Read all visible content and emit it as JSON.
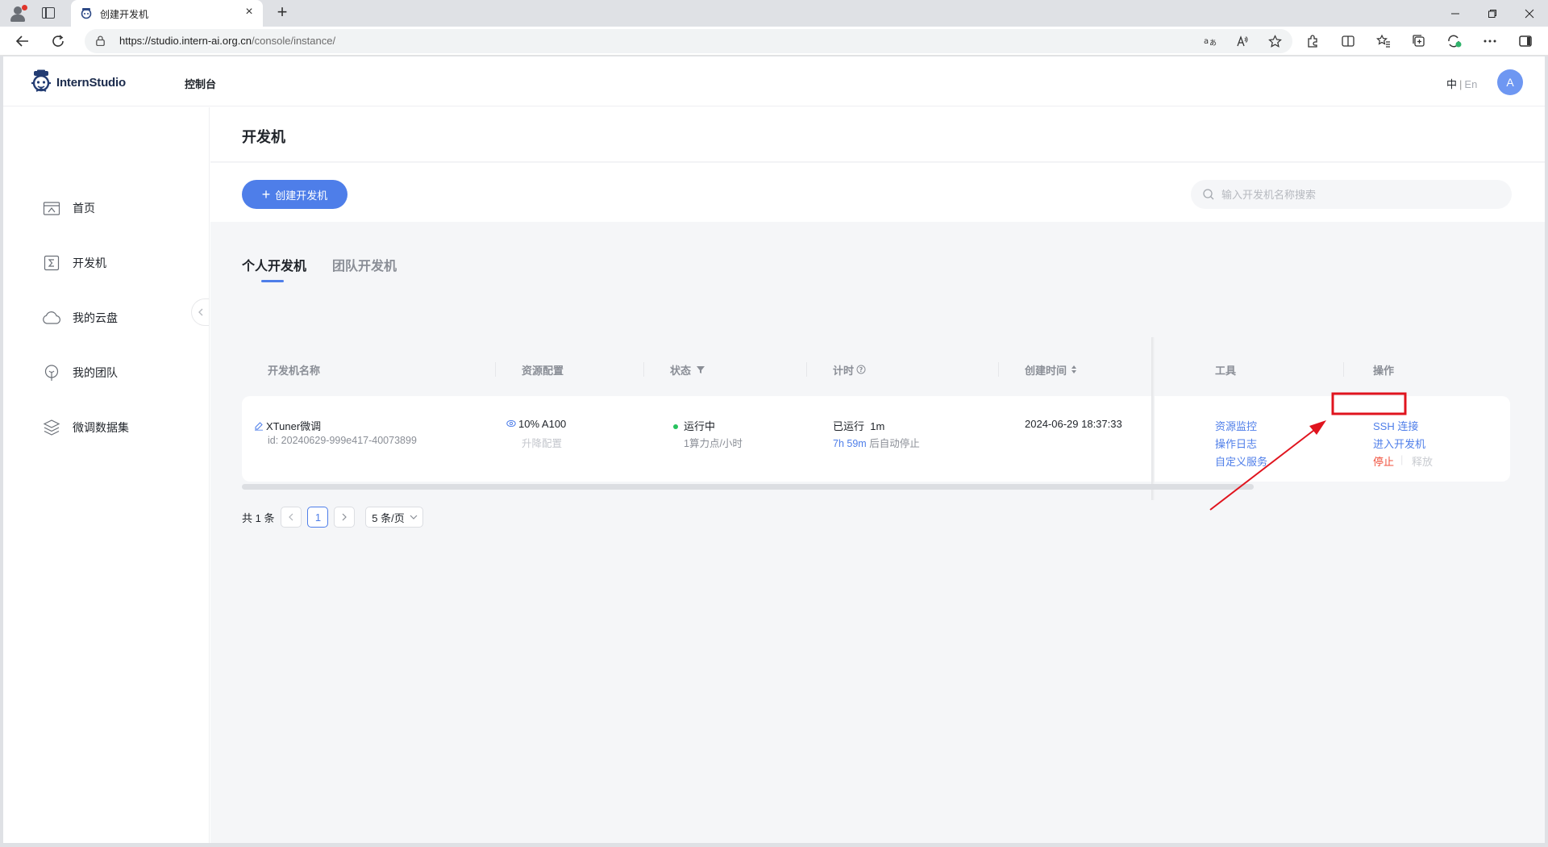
{
  "browser": {
    "tab_title": "创建开发机",
    "url_host": "https://studio.intern-ai.org.cn",
    "url_path": "/console/instance/",
    "new_tab": "+",
    "tab_close": "×"
  },
  "header": {
    "brand": "InternStudio",
    "nav_console": "控制台",
    "lang_zh": "中",
    "lang_sep": "|",
    "lang_en": "En",
    "avatar_letter": "A"
  },
  "sidebar": {
    "items": [
      {
        "label": "首页",
        "icon": "home-icon"
      },
      {
        "label": "开发机",
        "icon": "terminal-icon"
      },
      {
        "label": "我的云盘",
        "icon": "cloud-icon"
      },
      {
        "label": "我的团队",
        "icon": "team-icon"
      },
      {
        "label": "微调数据集",
        "icon": "layers-icon"
      }
    ]
  },
  "main": {
    "page_title": "开发机",
    "create_button": "创建开发机",
    "search_placeholder": "输入开发机名称搜索",
    "tabs": [
      "个人开发机",
      "团队开发机"
    ],
    "table": {
      "headers": [
        "开发机名称",
        "资源配置",
        "状态",
        "计时",
        "创建时间",
        "工具",
        "操作"
      ],
      "rows": [
        {
          "name": "XTuner微调",
          "id": "id: 20240629-999e417-40073899",
          "resource": "10% A100",
          "resource_action": "升降配置",
          "status": "运行中",
          "cost": "1算力点/小时",
          "timer_label": "已运行",
          "timer_value": "1m",
          "auto_stop_time": "7h 59m",
          "auto_stop_suffix": "后自动停止",
          "created": "2024-06-29 18:37:33",
          "tools": [
            "资源监控",
            "操作日志",
            "自定义服务"
          ],
          "ops": {
            "ssh": "SSH 连接",
            "enter": "进入开发机",
            "stop": "停止",
            "release": "释放"
          }
        }
      ]
    },
    "pagination": {
      "total": "共 1 条",
      "current_page": "1",
      "page_size": "5 条/页"
    }
  },
  "colors": {
    "accent": "#4e7ee9",
    "danger": "#f0503c",
    "running": "#27c25e",
    "annotation": "#e0141e"
  }
}
